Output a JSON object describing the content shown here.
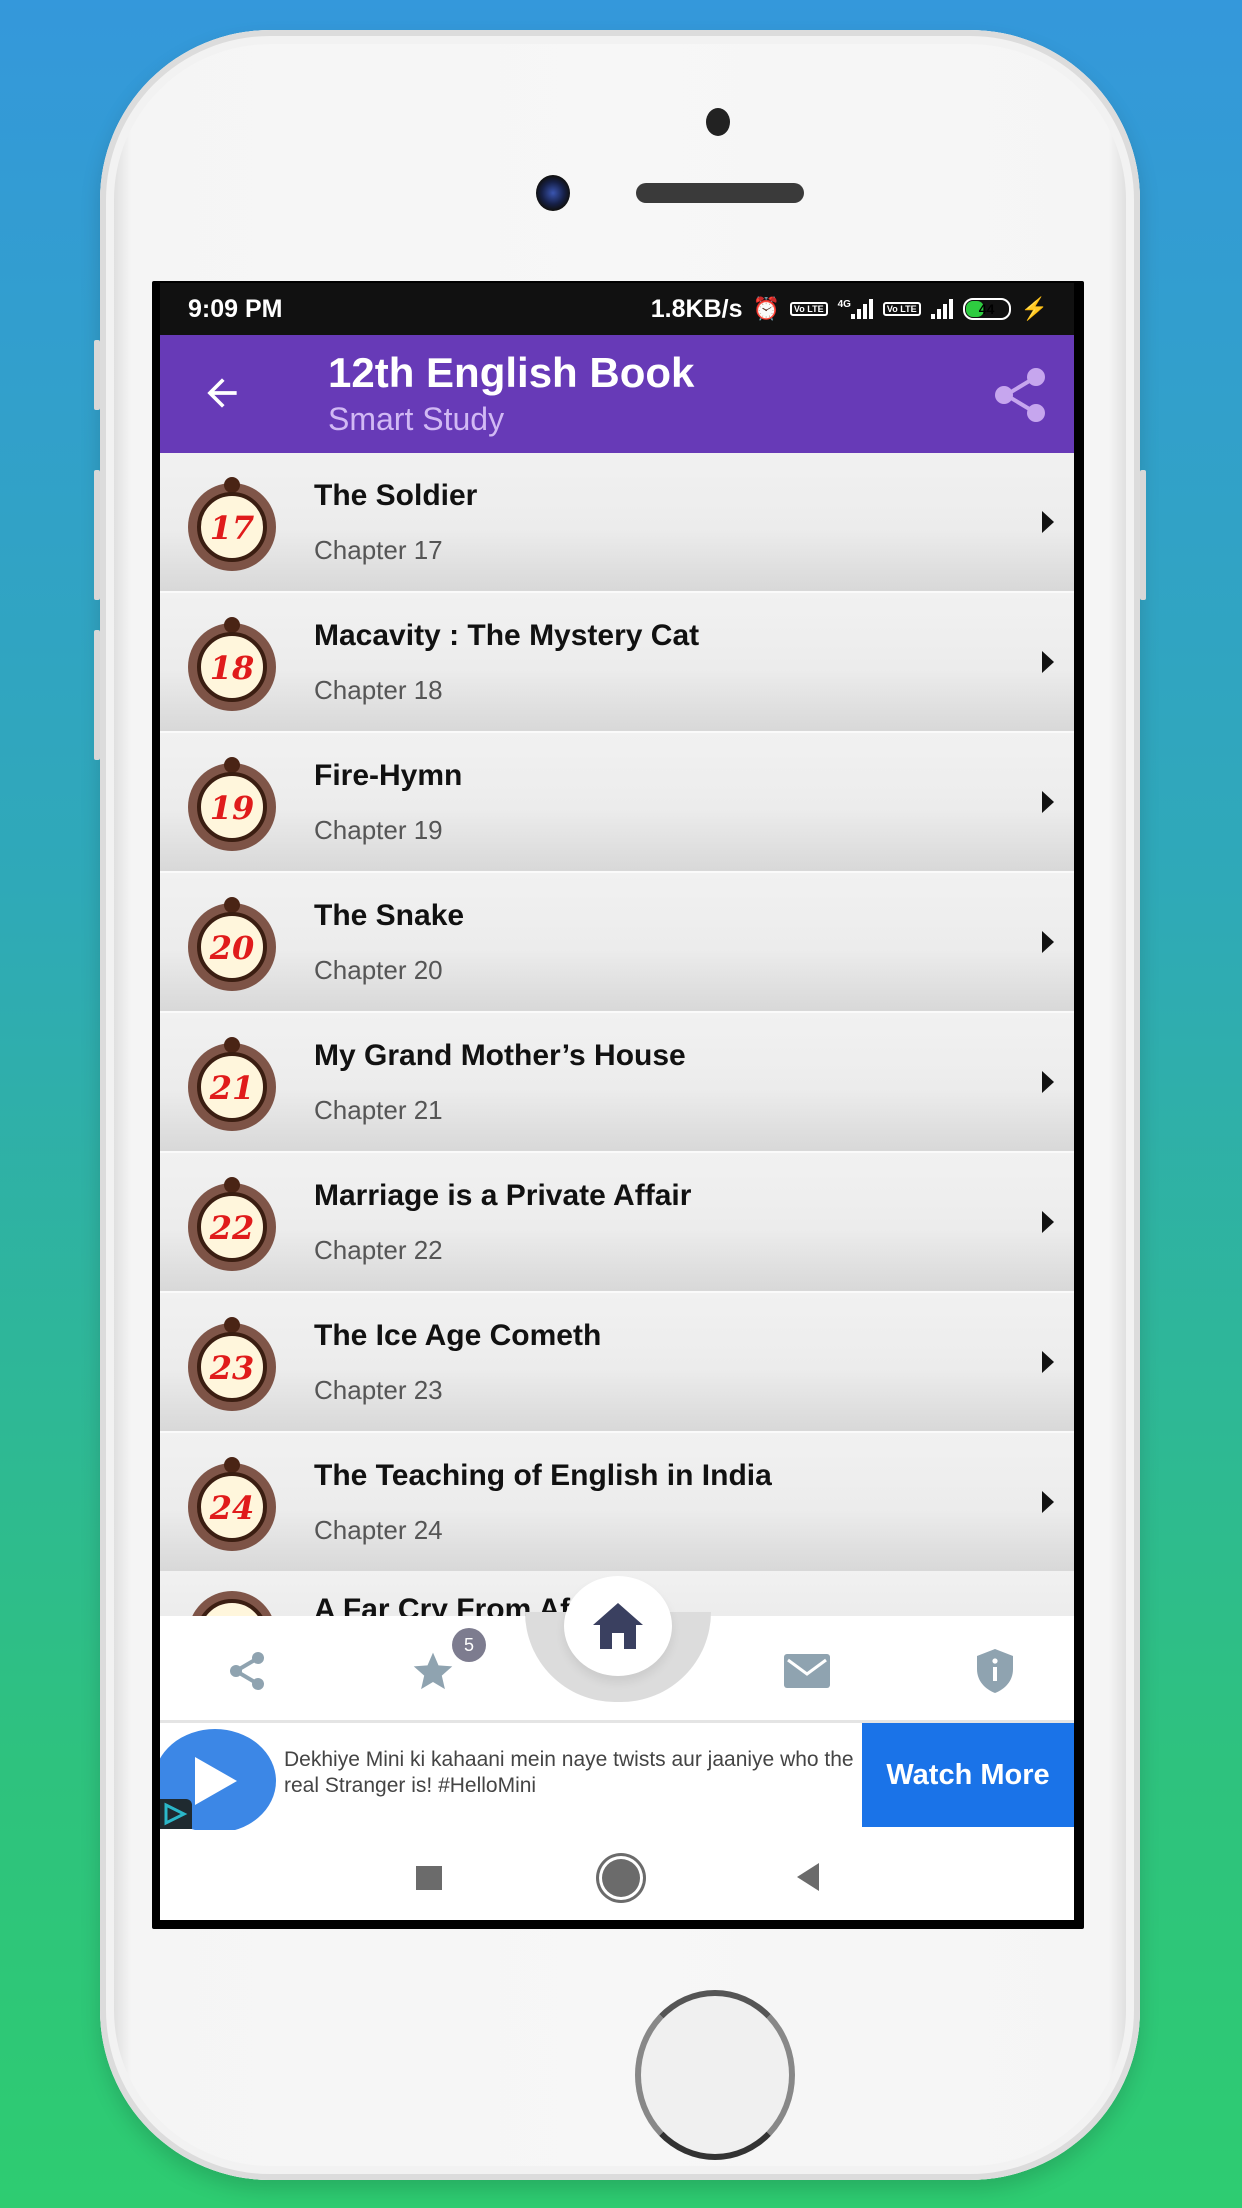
{
  "status_bar": {
    "time": "9:09 PM",
    "network_speed": "1.8KB/s",
    "icons": [
      "alarm-icon",
      "volte-icon",
      "4g-signal-icon",
      "volte-icon",
      "signal-icon",
      "battery-icon",
      "charging-icon"
    ],
    "network_type": "4G",
    "volte_label": "Vo LTE",
    "battery_level": "44"
  },
  "app_bar": {
    "title": "12th English Book",
    "subtitle": "Smart Study",
    "back_icon": "arrow-left-icon",
    "share_icon": "share-icon",
    "color": "#673ab7"
  },
  "chapters": [
    {
      "badge": "17",
      "title": "The Soldier",
      "subtitle": "Chapter 17"
    },
    {
      "badge": "18",
      "title": "Macavity : The Mystery Cat",
      "subtitle": "Chapter 18"
    },
    {
      "badge": "19",
      "title": "Fire-Hymn",
      "subtitle": "Chapter 19"
    },
    {
      "badge": "20",
      "title": "The Snake",
      "subtitle": "Chapter 20"
    },
    {
      "badge": "21",
      "title": "My Grand Mother’s House",
      "subtitle": "Chapter 21"
    },
    {
      "badge": "22",
      "title": "Marriage is a Private Affair",
      "subtitle": "Chapter 22"
    },
    {
      "badge": "23",
      "title": "The Ice Age Cometh",
      "subtitle": "Chapter 23"
    },
    {
      "badge": "24",
      "title": "The Teaching of English in India",
      "subtitle": "Chapter 24"
    }
  ],
  "partial_item": {
    "title": "A Far Cry From Af..."
  },
  "bottom_nav": {
    "items": [
      {
        "name": "share",
        "icon": "share-icon"
      },
      {
        "name": "favorites",
        "icon": "star-icon",
        "count": "5"
      },
      {
        "name": "home",
        "icon": "home-icon",
        "active": true
      },
      {
        "name": "mail",
        "icon": "mail-icon"
      },
      {
        "name": "privacy",
        "icon": "shield-info-icon"
      }
    ],
    "inactive_color": "#8fa3b0",
    "active_color": "#3a4060"
  },
  "ad": {
    "text": "Dekhiye Mini ki kahaani mein naye twists aur jaaniye who the real Stranger is! #HelloMini",
    "cta": "Watch More",
    "cta_color": "#1a73e8"
  },
  "system_nav": {
    "buttons": [
      "recents-icon",
      "home-circle-icon",
      "back-triangle-icon"
    ]
  }
}
